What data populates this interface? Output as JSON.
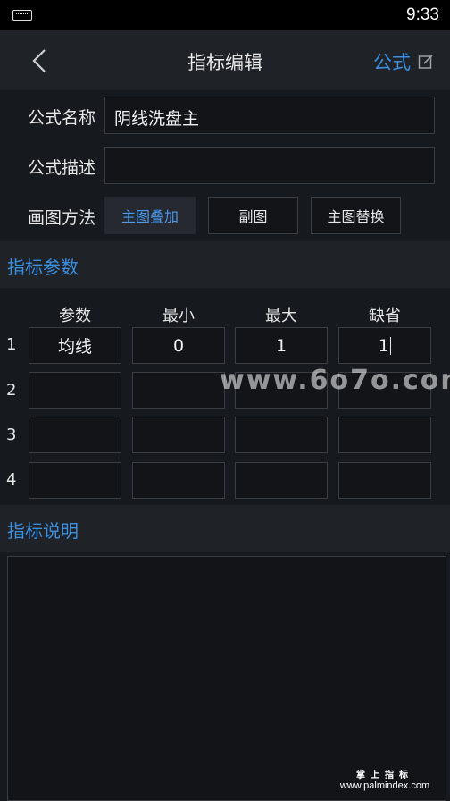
{
  "status_bar": {
    "time": "9:33",
    "keyboard_icon": "keyboard-icon"
  },
  "header": {
    "back_icon": "chevron-left-icon",
    "title": "指标编辑",
    "formula_label": "公式",
    "edit_icon": "edit-icon"
  },
  "form": {
    "name_label": "公式名称",
    "name_value": "阴线洗盘主",
    "desc_label": "公式描述",
    "desc_value": "",
    "draw_label": "画图方法",
    "draw_options": [
      "主图叠加",
      "副图",
      "主图替换"
    ],
    "draw_selected": "主图叠加"
  },
  "params": {
    "section_title": "指标参数",
    "columns": [
      "参数",
      "最小",
      "最大",
      "缺省"
    ],
    "rows": [
      {
        "num": "1",
        "cells": [
          "均线",
          "0",
          "1",
          "1"
        ]
      },
      {
        "num": "2",
        "cells": [
          "",
          "",
          "",
          ""
        ]
      },
      {
        "num": "3",
        "cells": [
          "",
          "",
          "",
          ""
        ]
      },
      {
        "num": "4",
        "cells": [
          "",
          "",
          "",
          ""
        ]
      }
    ]
  },
  "explain": {
    "section_title": "指标说明",
    "value": ""
  },
  "watermarks": {
    "site": "www.6o7o.com",
    "brand": "掌上指标",
    "url": "www.palmindex.com"
  },
  "colors": {
    "accent": "#3a8fe0",
    "background": "#16191d",
    "header": "#1f2226"
  }
}
